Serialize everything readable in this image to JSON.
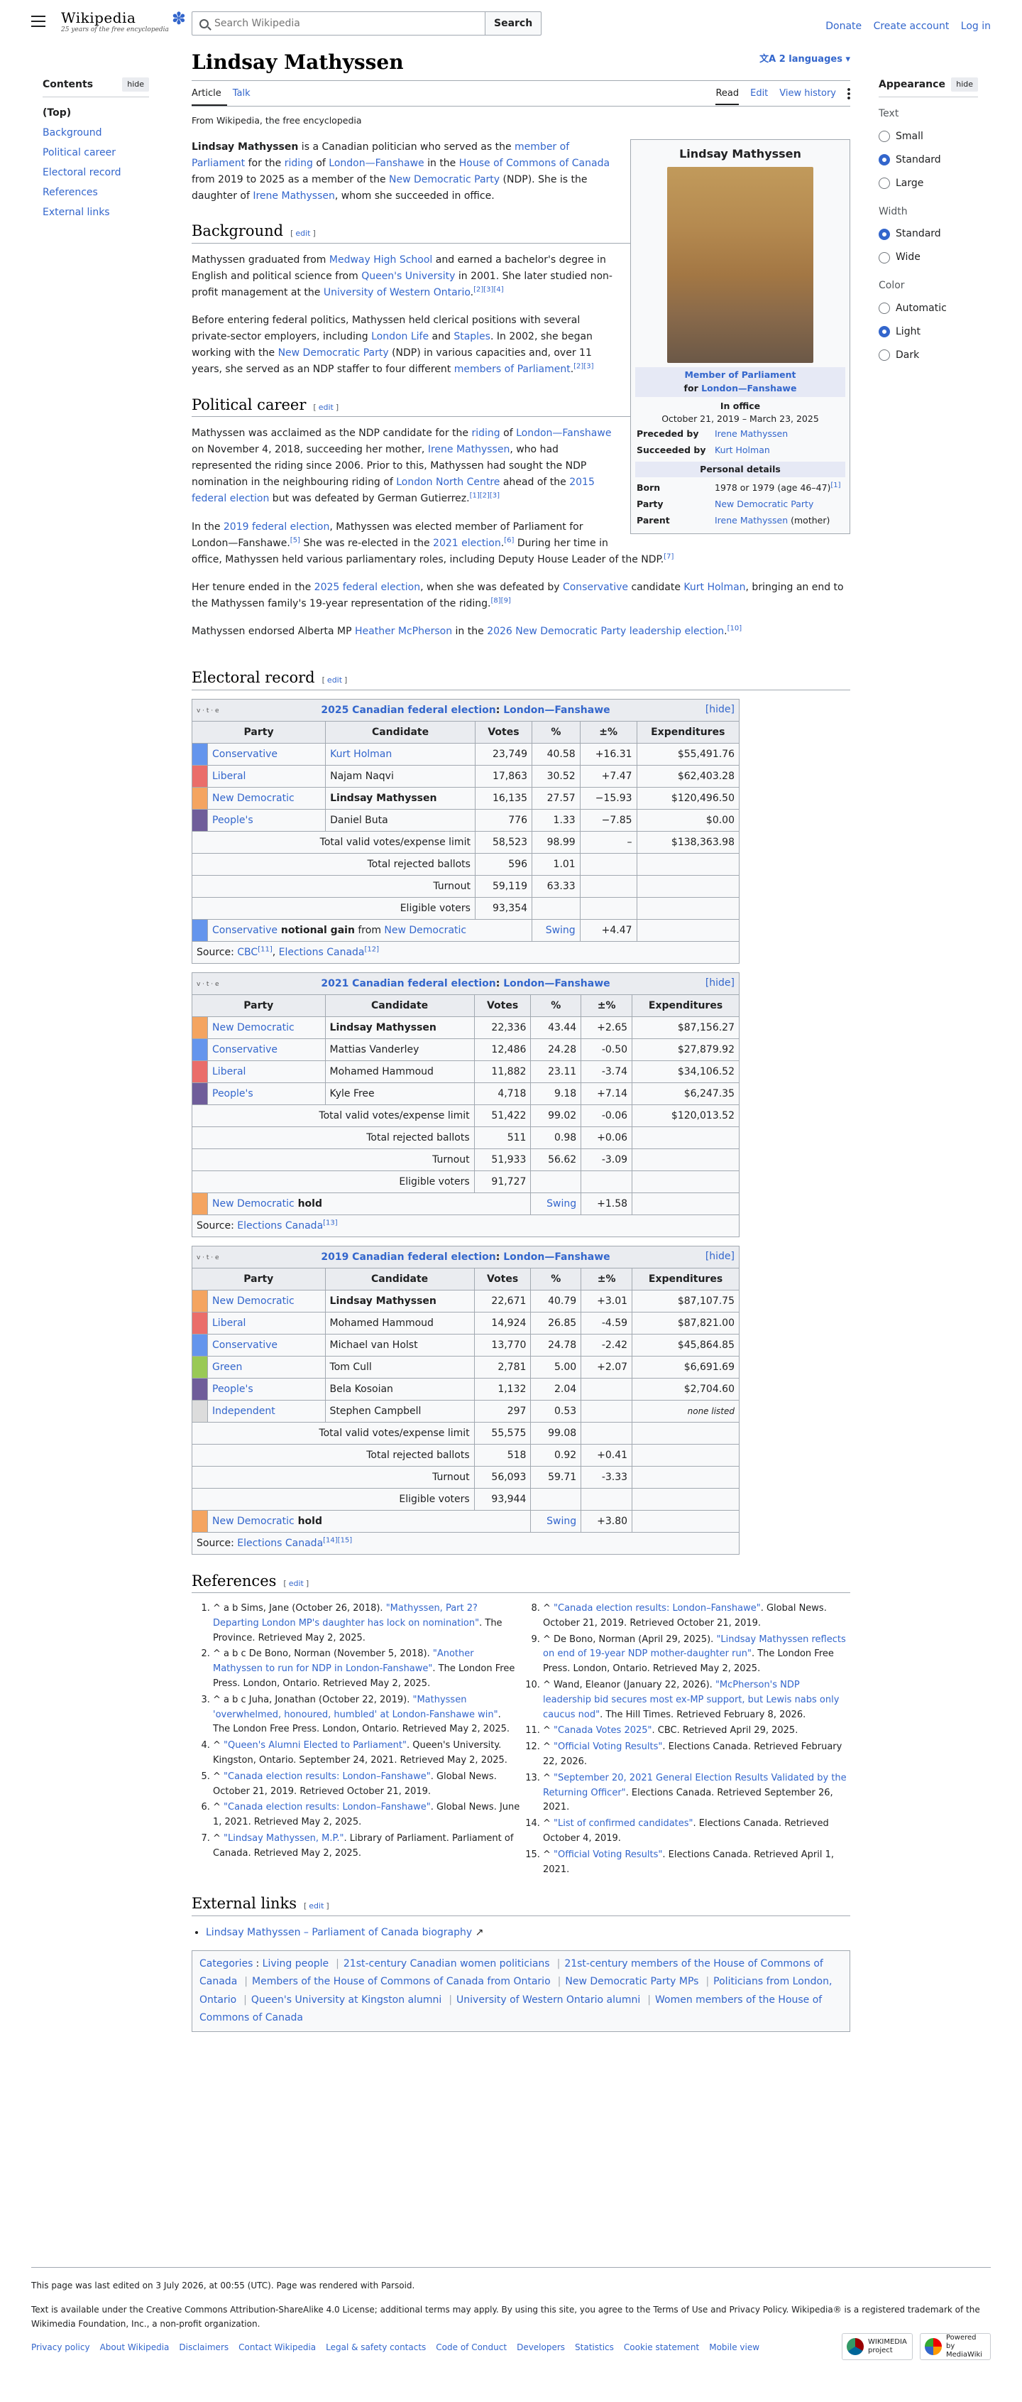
{
  "header": {
    "wordmark": "Wikipedia",
    "tagline": "25 years of the free encyclopedia",
    "search_placeholder": "Search Wikipedia",
    "search_button": "Search",
    "donate": "Donate",
    "create_account": "Create account",
    "log_in": "Log in"
  },
  "toc": {
    "title": "Contents",
    "hide": "hide",
    "items": [
      "(Top)",
      "Background",
      "Political career",
      "Electoral record",
      "References",
      "External links"
    ]
  },
  "appearance": {
    "title": "Appearance",
    "hide": "hide",
    "text_label": "Text",
    "text_opts": [
      "Small",
      "Standard",
      "Large"
    ],
    "width_label": "Width",
    "width_opts": [
      "Standard",
      "Wide"
    ],
    "color_label": "Color",
    "color_opts": [
      "Automatic",
      "Light",
      "Dark"
    ]
  },
  "page": {
    "title": "Lindsay Mathyssen",
    "languages": "2 languages",
    "tab_article": "Article",
    "tab_talk": "Talk",
    "tab_read": "Read",
    "tab_edit": "Edit",
    "tab_history": "View history",
    "from": "From Wikipedia, the free encyclopedia",
    "edit": "edit"
  },
  "infobox": {
    "name": "Lindsay Mathyssen",
    "office": "Member of Parliament",
    "office_for": "for",
    "riding": "London—Fanshawe",
    "in_office": "In office",
    "term": "October 21, 2019 – March 23, 2025",
    "preceded_label": "Preceded by",
    "preceded": "Irene Mathyssen",
    "succeeded_label": "Succeeded by",
    "succeeded": "Kurt Holman",
    "personal": "Personal details",
    "born_label": "Born",
    "born": "1978 or 1979 (age 46–47)",
    "born_ref": "[1]",
    "party_label": "Party",
    "party": "New Democratic Party",
    "parent_label": "Parent",
    "parent": "Irene Mathyssen",
    "parent_rel": "(mother)"
  },
  "intro": {
    "name": "Lindsay Mathyssen",
    "t1": " is a Canadian politician who served as the ",
    "l1": "member of Parliament",
    "t2": " for the ",
    "l2": "riding",
    "t3": " of ",
    "l3": "London—Fanshawe",
    "t4": " in the ",
    "l4": "House of Commons of Canada",
    "t5": " from 2019 to 2025 as a member of the ",
    "l5": "New Democratic Party",
    "t6": " (NDP). She is the daughter of ",
    "l6": "Irene Mathyssen",
    "t7": ", whom she succeeded in office."
  },
  "background": {
    "heading": "Background",
    "p1_a": "Mathyssen graduated from ",
    "p1_l1": "Medway High School",
    "p1_b": " and earned a bachelor's degree in English and political science from ",
    "p1_l2": "Queen's University",
    "p1_c": " in 2001. She later studied non-profit management at the ",
    "p1_l3": "University of Western Ontario",
    "p1_d": ".",
    "p1_refs": "[2][3][4]",
    "p2_a": "Before entering federal politics, Mathyssen held clerical positions with several private-sector employers, including ",
    "p2_l1": "London Life",
    "p2_b": " and ",
    "p2_l2": "Staples",
    "p2_c": ". In 2002, she began working with the ",
    "p2_l3": "New Democratic Party",
    "p2_d": " (NDP) in various capacities and, over 11 years, she served as an NDP staffer to four different ",
    "p2_l4": "members of Parliament",
    "p2_e": ".",
    "p2_refs": "[2][3]"
  },
  "career": {
    "heading": "Political career",
    "p1_a": "Mathyssen was acclaimed as the NDP candidate for the ",
    "p1_l1": "riding",
    "p1_b": " of ",
    "p1_l2": "London—Fanshawe",
    "p1_c": " on November 4, 2018, succeeding her mother, ",
    "p1_l3": "Irene Mathyssen",
    "p1_d": ", who had represented the riding since 2006. Prior to this, Mathyssen had sought the NDP nomination in the neighbouring riding of ",
    "p1_l4": "London North Centre",
    "p1_e": " ahead of the ",
    "p1_l5": "2015 federal election",
    "p1_f": " but was defeated by German Gutierrez.",
    "p1_refs": "[1][2][3]",
    "p2_a": "In the ",
    "p2_l1": "2019 federal election",
    "p2_b": ", Mathyssen was elected member of Parliament for London—Fanshawe.",
    "p2_r1": "[5]",
    "p2_c": " She was re-elected in the ",
    "p2_l2": "2021 election",
    "p2_d": ".",
    "p2_r2": "[6]",
    "p2_e": " During her time in office, Mathyssen held various parliamentary roles, including Deputy House Leader of the NDP.",
    "p2_r3": "[7]",
    "p3_a": "Her tenure ended in the ",
    "p3_l1": "2025 federal election",
    "p3_b": ", when she was defeated by ",
    "p3_l2": "Conservative",
    "p3_c": " candidate ",
    "p3_l3": "Kurt Holman",
    "p3_d": ", bringing an end to the Mathyssen family's 19-year representation of the riding.",
    "p3_refs": "[8][9]",
    "p4_a": "Mathyssen endorsed Alberta MP ",
    "p4_l1": "Heather McPherson",
    "p4_b": " in the ",
    "p4_l2": "2026 New Democratic Party leadership election",
    "p4_c": ".",
    "p4_refs": "[10]"
  },
  "electoral": {
    "heading": "Electoral record",
    "vte": "v · t · e",
    "hide": "[hide]",
    "cols": [
      "Party",
      "Candidate",
      "Votes",
      "%",
      "±%",
      "Expenditures"
    ],
    "tables": [
      {
        "year_link": "2025 Canadian federal election",
        "sep": ": ",
        "riding": "London—Fanshawe",
        "rows": [
          {
            "color": "#6495ED",
            "party": "Conservative",
            "cand": "Kurt Holman",
            "cand_link": true,
            "bold": false,
            "votes": "23,749",
            "pct": "40.58",
            "chg": "+16.31",
            "exp": "$55,491.76"
          },
          {
            "color": "#EA6D6A",
            "party": "Liberal",
            "cand": "Najam Naqvi",
            "cand_link": false,
            "bold": false,
            "votes": "17,863",
            "pct": "30.52",
            "chg": "+7.47",
            "exp": "$62,403.28"
          },
          {
            "color": "#F4A460",
            "party": "New Democratic",
            "cand": "Lindsay Mathyssen",
            "cand_link": false,
            "bold": true,
            "votes": "16,135",
            "pct": "27.57",
            "chg": "−15.93",
            "exp": "$120,496.50"
          },
          {
            "color": "#6F5D9A",
            "party": "People's",
            "cand": "Daniel Buta",
            "cand_link": false,
            "bold": false,
            "votes": "776",
            "pct": "1.33",
            "chg": "−7.85",
            "exp": "$0.00"
          }
        ],
        "totals": [
          {
            "label": "Total valid votes/expense limit",
            "votes": "58,523",
            "pct": "98.99",
            "chg": "–",
            "exp": "$138,363.98"
          },
          {
            "label": "Total rejected ballots",
            "votes": "596",
            "pct": "1.01",
            "chg": "",
            "exp": ""
          },
          {
            "label": "Turnout",
            "votes": "59,119",
            "pct": "63.33",
            "chg": "",
            "exp": ""
          },
          {
            "label": "Eligible voters",
            "votes": "93,354",
            "pct": "",
            "chg": "",
            "exp": ""
          }
        ],
        "result": {
          "color": "#6495ED",
          "party": "Conservative",
          "word": " notional",
          "gain": " gain",
          "from": " from ",
          "from_party": "New Democratic",
          "swing": "Swing",
          "val": "+4.47"
        },
        "source_label": "Source: ",
        "sources": [
          {
            "t": "CBC",
            "r": "[11]"
          },
          {
            "t": "Elections Canada",
            "r": "[12]"
          }
        ]
      },
      {
        "year_link": "2021 Canadian federal election",
        "sep": ": ",
        "riding": "London—Fanshawe",
        "rows": [
          {
            "color": "#F4A460",
            "party": "New Democratic",
            "cand": "Lindsay Mathyssen",
            "cand_link": false,
            "bold": true,
            "votes": "22,336",
            "pct": "43.44",
            "chg": "+2.65",
            "exp": "$87,156.27"
          },
          {
            "color": "#6495ED",
            "party": "Conservative",
            "cand": "Mattias Vanderley",
            "cand_link": false,
            "bold": false,
            "votes": "12,486",
            "pct": "24.28",
            "chg": "-0.50",
            "exp": "$27,879.92"
          },
          {
            "color": "#EA6D6A",
            "party": "Liberal",
            "cand": "Mohamed Hammoud",
            "cand_link": false,
            "bold": false,
            "votes": "11,882",
            "pct": "23.11",
            "chg": "-3.74",
            "exp": "$34,106.52"
          },
          {
            "color": "#6F5D9A",
            "party": "People's",
            "cand": "Kyle Free",
            "cand_link": false,
            "bold": false,
            "votes": "4,718",
            "pct": "9.18",
            "chg": "+7.14",
            "exp": "$6,247.35"
          }
        ],
        "totals": [
          {
            "label": "Total valid votes/expense limit",
            "votes": "51,422",
            "pct": "99.02",
            "chg": "-0.06",
            "exp": "$120,013.52"
          },
          {
            "label": "Total rejected ballots",
            "votes": "511",
            "pct": "0.98",
            "chg": "+0.06",
            "exp": ""
          },
          {
            "label": "Turnout",
            "votes": "51,933",
            "pct": "56.62",
            "chg": "-3.09",
            "exp": ""
          },
          {
            "label": "Eligible voters",
            "votes": "91,727",
            "pct": "",
            "chg": "",
            "exp": ""
          }
        ],
        "result": {
          "color": "#F4A460",
          "party": "New Democratic",
          "word": "",
          "gain": " hold",
          "from": "",
          "from_party": "",
          "swing": "Swing",
          "val": "+1.58"
        },
        "source_label": "Source: ",
        "sources": [
          {
            "t": "Elections Canada",
            "r": "[13]"
          }
        ]
      },
      {
        "year_link": "2019 Canadian federal election",
        "sep": ": ",
        "riding": "London—Fanshawe",
        "rows": [
          {
            "color": "#F4A460",
            "party": "New Democratic",
            "cand": "Lindsay Mathyssen",
            "cand_link": false,
            "bold": true,
            "votes": "22,671",
            "pct": "40.79",
            "chg": "+3.01",
            "exp": "$87,107.75"
          },
          {
            "color": "#EA6D6A",
            "party": "Liberal",
            "cand": "Mohamed Hammoud",
            "cand_link": false,
            "bold": false,
            "votes": "14,924",
            "pct": "26.85",
            "chg": "-4.59",
            "exp": "$87,821.00"
          },
          {
            "color": "#6495ED",
            "party": "Conservative",
            "cand": "Michael van Holst",
            "cand_link": false,
            "bold": false,
            "votes": "13,770",
            "pct": "24.78",
            "chg": "-2.42",
            "exp": "$45,864.85"
          },
          {
            "color": "#99C955",
            "party": "Green",
            "cand": "Tom Cull",
            "cand_link": false,
            "bold": false,
            "votes": "2,781",
            "pct": "5.00",
            "chg": "+2.07",
            "exp": "$6,691.69"
          },
          {
            "color": "#6F5D9A",
            "party": "People's",
            "cand": "Bela Kosoian",
            "cand_link": false,
            "bold": false,
            "votes": "1,132",
            "pct": "2.04",
            "chg": "",
            "exp": "$2,704.60"
          },
          {
            "color": "#DCDCDC",
            "party": "Independent",
            "cand": "Stephen Campbell",
            "cand_link": false,
            "bold": false,
            "votes": "297",
            "pct": "0.53",
            "chg": "",
            "exp": "none listed",
            "exp_it": true
          }
        ],
        "totals": [
          {
            "label": "Total valid votes/expense limit",
            "votes": "55,575",
            "pct": "99.08",
            "chg": "",
            "exp": ""
          },
          {
            "label": "Total rejected ballots",
            "votes": "518",
            "pct": "0.92",
            "chg": "+0.41",
            "exp": ""
          },
          {
            "label": "Turnout",
            "votes": "56,093",
            "pct": "59.71",
            "chg": "-3.33",
            "exp": ""
          },
          {
            "label": "Eligible voters",
            "votes": "93,944",
            "pct": "",
            "chg": "",
            "exp": ""
          }
        ],
        "result": {
          "color": "#F4A460",
          "party": "New Democratic",
          "word": "",
          "gain": " hold",
          "from": "",
          "from_party": "",
          "swing": "Swing",
          "val": "+3.80"
        },
        "source_label": "Source: ",
        "sources": [
          {
            "t": "Elections Canada",
            "r": "[14][15]"
          }
        ]
      }
    ]
  },
  "references": {
    "heading": "References",
    "items": [
      {
        "pre": "^ a b Sims, Jane (October 26, 2018). ",
        "title": "\"Mathyssen, Part 2? Departing London MP's daughter has lock on nomination\"",
        "post": ". The Province. Retrieved May 2, 2025."
      },
      {
        "pre": "^ a b c De Bono, Norman (November 5, 2018). ",
        "title": "\"Another Mathyssen to run for NDP in London-Fanshawe\"",
        "post": ". The London Free Press. London, Ontario. Retrieved May 2, 2025."
      },
      {
        "pre": "^ a b c Juha, Jonathan (October 22, 2019). ",
        "title": "\"Mathyssen 'overwhelmed, honoured, humbled' at London-Fanshawe win\"",
        "post": ". The London Free Press. London, Ontario. Retrieved May 2, 2025."
      },
      {
        "pre": "^ ",
        "title": "\"Queen's Alumni Elected to Parliament\"",
        "post": ". Queen's University. Kingston, Ontario. September 24, 2021. Retrieved May 2, 2025."
      },
      {
        "pre": "^ ",
        "title": "\"Canada election results: London–Fanshawe\"",
        "post": ". Global News. October 21, 2019. Retrieved October 21, 2019."
      },
      {
        "pre": "^ ",
        "title": "\"Canada election results: London–Fanshawe\"",
        "post": ". Global News. June 1, 2021. Retrieved May 2, 2025."
      },
      {
        "pre": "^ ",
        "title": "\"Lindsay Mathyssen, M.P.\"",
        "post": ". Library of Parliament. Parliament of Canada. Retrieved May 2, 2025."
      },
      {
        "pre": "^ ",
        "title": "\"Canada election results: London–Fanshawe\"",
        "post": ". Global News. October 21, 2019. Retrieved October 21, 2019."
      },
      {
        "pre": "^ De Bono, Norman (April 29, 2025). ",
        "title": "\"Lindsay Mathyssen reflects on end of 19-year NDP mother-daughter run\"",
        "post": ". The London Free Press. London, Ontario. Retrieved May 2, 2025."
      },
      {
        "pre": "^ Wand, Eleanor (January 22, 2026). ",
        "title": "\"McPherson's NDP leadership bid secures most ex-MP support, but Lewis nabs only caucus nod\"",
        "post": ". The Hill Times. Retrieved February 8, 2026."
      },
      {
        "pre": "^ ",
        "title": "\"Canada Votes 2025\"",
        "post": ". CBC. Retrieved April 29, 2025."
      },
      {
        "pre": "^ ",
        "title": "\"Official Voting Results\"",
        "post": ". Elections Canada. Retrieved February 22, 2026."
      },
      {
        "pre": "^ ",
        "title": "\"September 20, 2021 General Election Results Validated by the Returning Officer\"",
        "post": ". Elections Canada. Retrieved September 26, 2021."
      },
      {
        "pre": "^ ",
        "title": "\"List of confirmed candidates\"",
        "post": ". Elections Canada. Retrieved October 4, 2019."
      },
      {
        "pre": "^ ",
        "title": "\"Official Voting Results\"",
        "post": ". Elections Canada. Retrieved April 1, 2021."
      }
    ]
  },
  "external": {
    "heading": "External links",
    "items": [
      "Lindsay Mathyssen – Parliament of Canada biography"
    ]
  },
  "categories": {
    "label": "Categories",
    "items": [
      "Living people",
      "21st-century Canadian women politicians",
      "21st-century members of the House of Commons of Canada",
      "Members of the House of Commons of Canada from Ontario",
      "New Democratic Party MPs",
      "Politicians from London, Ontario",
      "Queen's University at Kingston alumni",
      "University of Western Ontario alumni",
      "Women members of the House of Commons of Canada"
    ]
  },
  "footer": {
    "edited": "This page was last edited on 3 July 2026, at 00:55 (UTC). Page was rendered with Parsoid.",
    "license": "Text is available under the Creative Commons Attribution-ShareAlike 4.0 License; additional terms may apply. By using this site, you agree to the Terms of Use and Privacy Policy. Wikipedia® is a registered trademark of the Wikimedia Foundation, Inc., a non-profit organization.",
    "links": [
      "Privacy policy",
      "About Wikipedia",
      "Disclaimers",
      "Contact Wikipedia",
      "Legal & safety contacts",
      "Code of Conduct",
      "Developers",
      "Statistics",
      "Cookie statement",
      "Mobile view"
    ],
    "badge1": "WIKIMEDIA project",
    "badge2": "Powered by MediaWiki"
  }
}
